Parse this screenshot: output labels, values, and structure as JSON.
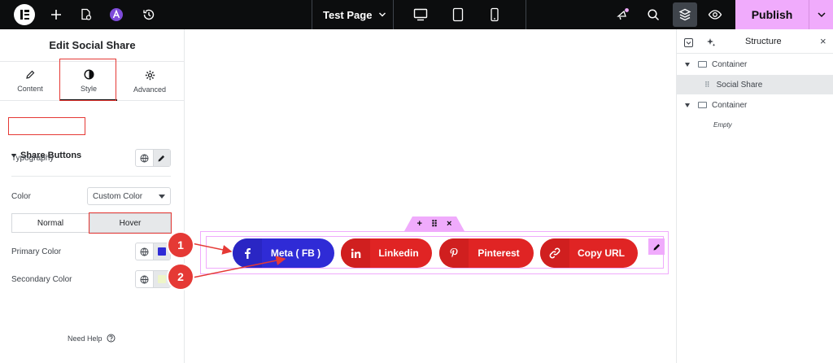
{
  "topbar": {
    "page_title": "Test Page",
    "publish_label": "Publish"
  },
  "left_panel": {
    "title": "Edit Social Share",
    "tabs": [
      {
        "label": "Content"
      },
      {
        "label": "Style"
      },
      {
        "label": "Advanced"
      }
    ],
    "active_tab": "Style",
    "section_title": "Share Buttons",
    "typography_label": "Typography",
    "color_label": "Color",
    "color_select_value": "Custom Color",
    "state_tabs": [
      {
        "label": "Normal"
      },
      {
        "label": "Hover"
      }
    ],
    "active_state": "Hover",
    "primary_color_label": "Primary Color",
    "secondary_color_label": "Secondary Color",
    "primary_color_value": "#2f2bd6",
    "secondary_color_value": "#eef5c8",
    "need_help_label": "Need Help"
  },
  "canvas": {
    "share_buttons": [
      {
        "label": "Meta ( FB )",
        "icon": "facebook-icon",
        "color": "#2f2bd6",
        "icon_bg": "#2a26c4"
      },
      {
        "label": "Linkedin",
        "icon": "linkedin-icon",
        "color": "#e02424",
        "icon_bg": "#d01f1f"
      },
      {
        "label": "Pinterest",
        "icon": "pinterest-icon",
        "color": "#e02424",
        "icon_bg": "#d01f1f"
      },
      {
        "label": "Copy URL",
        "icon": "link-icon",
        "color": "#e02424",
        "icon_bg": "#d01f1f"
      }
    ],
    "markers": [
      {
        "number": "1"
      },
      {
        "number": "2"
      }
    ]
  },
  "structure_panel": {
    "title": "Structure",
    "items": [
      {
        "label": "Container"
      },
      {
        "label": "Social Share"
      },
      {
        "label": "Container"
      },
      {
        "label": "Empty"
      }
    ]
  },
  "colors": {
    "accent": "#f0abfc",
    "annotation_red": "#e53935",
    "topbar_bg": "#0c0d0e"
  }
}
